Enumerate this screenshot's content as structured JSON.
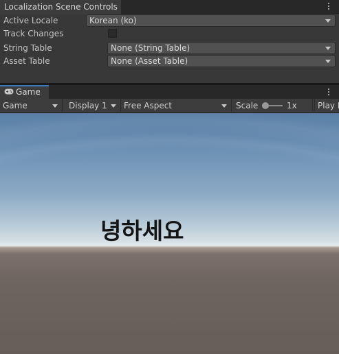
{
  "localization_panel": {
    "tab_title": "Localization Scene Controls",
    "active_locale": {
      "label": "Active Locale",
      "value": "Korean (ko)"
    },
    "track_changes": {
      "label": "Track Changes",
      "checked": false
    },
    "string_table": {
      "label": "String Table",
      "value": "None (String Table)"
    },
    "asset_table": {
      "label": "Asset Table",
      "value": "None (Asset Table)"
    }
  },
  "game_view": {
    "tab_title": "Game",
    "toolbar": {
      "display_mode": "Game",
      "display": "Display 1",
      "aspect": "Free Aspect",
      "scale_label": "Scale",
      "scale_value": "1x",
      "play_label": "Play I"
    },
    "scene_text": "녕하세요"
  },
  "colors": {
    "panel_bg": "#383838",
    "tab_accent": "#3a79bb",
    "dropdown_bg": "#515151"
  }
}
